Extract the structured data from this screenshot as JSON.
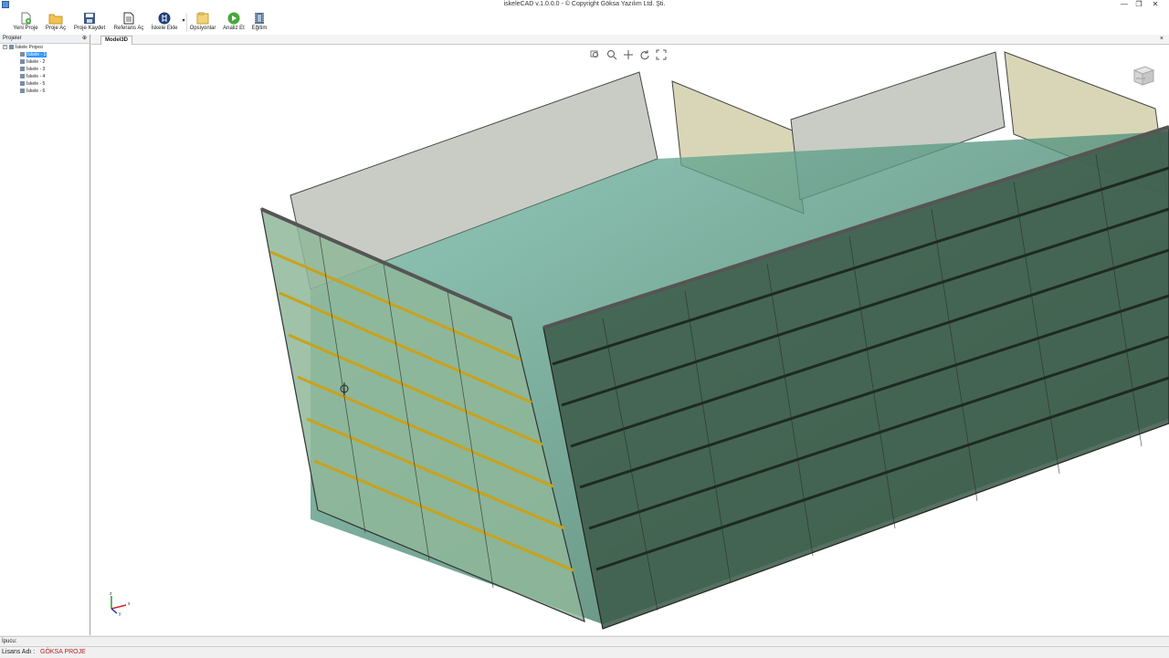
{
  "window": {
    "title": "iskeleCAD v.1.0.0.0 - © Copyright Göksa Yazılım Ltd. Şti.",
    "minimize": "—",
    "maximize": "❐",
    "close": "✕"
  },
  "toolbar": {
    "buttons": [
      {
        "label": "Yeni Proje",
        "icon": "new-file-icon"
      },
      {
        "label": "Proje Aç",
        "icon": "folder-open-icon"
      },
      {
        "label": "Proje Kaydet",
        "icon": "save-icon"
      },
      {
        "label": "Referans Aç",
        "icon": "document-icon"
      },
      {
        "label": "İskele Ekle",
        "icon": "scaffold-icon"
      },
      {
        "label": "Opsiyonlar",
        "icon": "options-folder-icon"
      },
      {
        "label": "Analiz Et",
        "icon": "analyze-icon"
      },
      {
        "label": "Eğitim",
        "icon": "film-icon"
      }
    ]
  },
  "projects_panel": {
    "title": "Projeler",
    "pin": "⊕",
    "root": "İskele Projesi",
    "expander": "−",
    "items": [
      {
        "label": "İskele - 1",
        "selected": true
      },
      {
        "label": "İskele - 2",
        "selected": false
      },
      {
        "label": "İskele - 3",
        "selected": false
      },
      {
        "label": "İskele - 4",
        "selected": false
      },
      {
        "label": "İskele - 5",
        "selected": false
      },
      {
        "label": "İskele - 6",
        "selected": false
      }
    ]
  },
  "viewport": {
    "tab": "Model3D",
    "tab_close": "×",
    "tools": [
      "zoom-window-icon",
      "zoom-icon",
      "pan-icon",
      "rotate-icon",
      "fit-icon"
    ],
    "cube_face": "FRONT",
    "axis_labels": {
      "z": "z",
      "x": "x",
      "y": "y"
    }
  },
  "status": {
    "hint_label": "İpucu:",
    "license_label": "Lisans Adı :",
    "license_value": "GÖKSA PROJE"
  }
}
